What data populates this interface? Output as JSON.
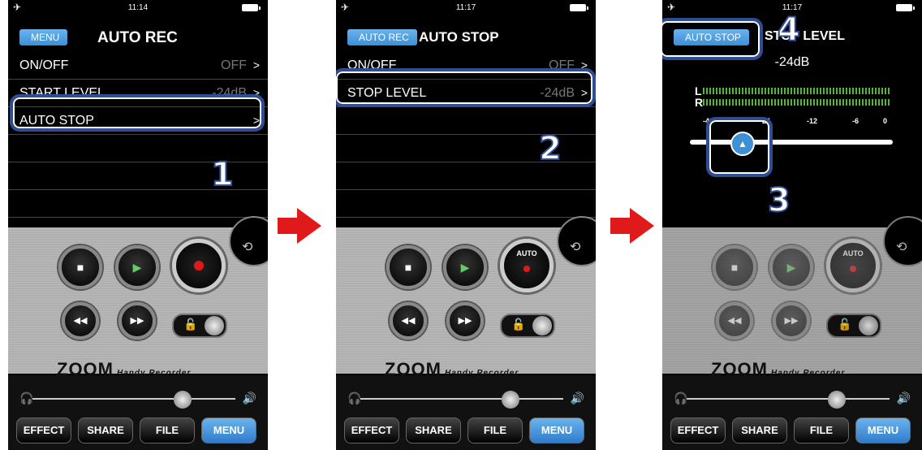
{
  "screens": [
    {
      "status_time": "11:14",
      "back_label": "MENU",
      "title": "AUTO REC",
      "rows": [
        {
          "label": "ON/OFF",
          "value": "OFF"
        },
        {
          "label": "START LEVEL",
          "value": "-24dB"
        },
        {
          "label": "AUTO STOP",
          "value": ""
        }
      ],
      "step": "1"
    },
    {
      "status_time": "11:17",
      "back_label": "AUTO REC",
      "title": "AUTO STOP",
      "rows": [
        {
          "label": "ON/OFF",
          "value": "OFF"
        },
        {
          "label": "STOP LEVEL",
          "value": "-24dB"
        }
      ],
      "step": "2"
    },
    {
      "status_time": "11:17",
      "back_label": "AUTO STOP",
      "title": "STOP LEVEL",
      "level_value": "-24dB",
      "meter_labels": [
        "L",
        "R"
      ],
      "meter_ticks": [
        "-48",
        "-24",
        "-12",
        "-6",
        "0"
      ],
      "steps": [
        "3",
        "4"
      ]
    }
  ],
  "transport": {
    "auto_label": "AUTO",
    "brand": "ZOOM",
    "brand_sub": "Handy Recorder"
  },
  "tabs": [
    "EFFECT",
    "SHARE",
    "FILE",
    "MENU"
  ],
  "icons": {
    "airplane": "airplane-icon",
    "battery": "battery-icon",
    "chevron": "chevron-right-icon",
    "stop": "stop-icon",
    "play": "play-icon",
    "record": "record-icon",
    "rewind": "rewind-icon",
    "fastforward": "fast-forward-icon",
    "lock": "lock-icon",
    "headphones": "headphones-icon",
    "speaker": "speaker-icon",
    "flip": "rotate-icon"
  },
  "colors": {
    "accent": "#3d8fd6",
    "highlight": "#2f4d91",
    "arrow": "#e01a1a"
  }
}
